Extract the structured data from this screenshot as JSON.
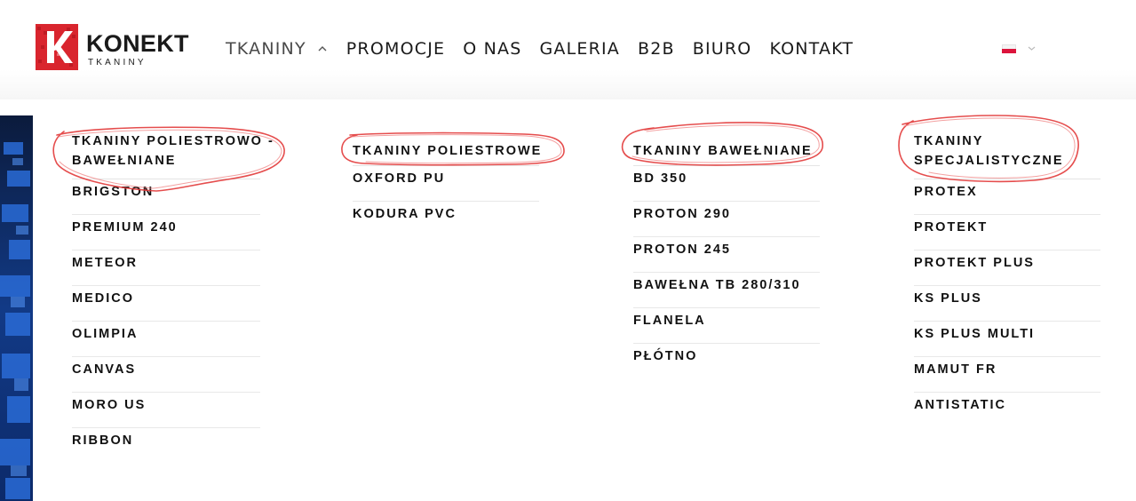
{
  "brand": {
    "name": "KONEKT",
    "subtitle": "TKANINY",
    "colors": {
      "accent": "#d9252e",
      "text": "#1a1a1a",
      "highlight": "#e03a3a"
    }
  },
  "nav": {
    "items": [
      {
        "label": "TKANINY",
        "active": true,
        "has_submenu": true,
        "submenu_icon": "chevron-up-icon"
      },
      {
        "label": "PROMOCJE"
      },
      {
        "label": "O NAS"
      },
      {
        "label": "GALERIA"
      },
      {
        "label": "B2B"
      },
      {
        "label": "BIURO"
      },
      {
        "label": "KONTAKT"
      }
    ],
    "language": {
      "icon": "polish-flag-icon",
      "dropdown_icon": "chevron-down-icon"
    }
  },
  "menu": {
    "columns": [
      {
        "heading_lines": [
          "TKANINY POLIESTROWO -",
          "BAWEŁNIANE"
        ],
        "items": [
          "BRIGSTON",
          "PREMIUM 240",
          "METEOR",
          "MEDICO",
          "OLIMPIA",
          "CANVAS",
          "MORO US",
          "RIBBON"
        ]
      },
      {
        "heading_lines": [
          "TKANINY POLIESTROWE"
        ],
        "items": [
          "OXFORD PU",
          "KODURA PVC"
        ]
      },
      {
        "heading_lines": [
          "TKANINY BAWEŁNIANE"
        ],
        "items": [
          "BD 350",
          "PROTON 290",
          "PROTON 245",
          "BAWEŁNA TB 280/310",
          "FLANELA",
          "PŁÓTNO"
        ]
      },
      {
        "heading_lines": [
          "TKANINY",
          "SPECJALISTYCZNE"
        ],
        "items": [
          "PROTEX",
          "PROTEKT",
          "PROTEKT PLUS",
          "KS PLUS",
          "KS PLUS MULTI",
          "MAMUT FR",
          "ANTISTATIC"
        ]
      }
    ]
  }
}
